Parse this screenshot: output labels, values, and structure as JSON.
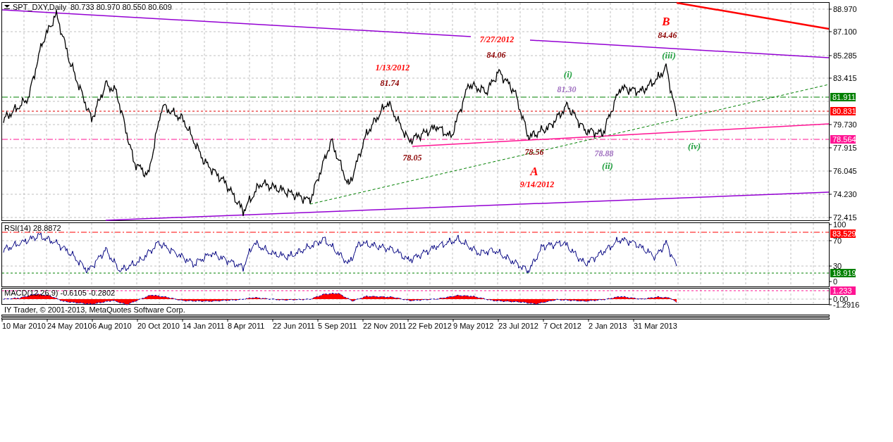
{
  "chart_header": {
    "symbol": "SPT_DXY,Daily",
    "ohlc": "80.733 80.970 80.550 80.609"
  },
  "price_axis": [
    {
      "kind": "tick",
      "text": "88.970"
    },
    {
      "kind": "tick",
      "text": "87.100"
    },
    {
      "kind": "tick",
      "text": "85.285"
    },
    {
      "kind": "tick",
      "text": "83.415"
    },
    {
      "kind": "tag",
      "text": "81.911",
      "color": "#008000"
    },
    {
      "kind": "tag",
      "text": "80.831",
      "color": "#ff0000"
    },
    {
      "kind": "tick",
      "text": "79.730"
    },
    {
      "kind": "tag",
      "text": "78.564",
      "color": "#ff1493"
    },
    {
      "kind": "tick",
      "text": "77.915"
    },
    {
      "kind": "tick",
      "text": "76.045"
    },
    {
      "kind": "tick",
      "text": "74.230"
    },
    {
      "kind": "tick",
      "text": "72.415"
    }
  ],
  "annotations": [
    {
      "kind": "wave",
      "text": "B",
      "color": "#ff0000"
    },
    {
      "kind": "price",
      "text": "84.46",
      "color": "#8b0000"
    },
    {
      "kind": "count",
      "text": "(iii)",
      "color": "#22a040"
    },
    {
      "kind": "date",
      "text": "7/27/2012",
      "color": "#ff0000"
    },
    {
      "kind": "price",
      "text": "84.06",
      "color": "#8b0000"
    },
    {
      "kind": "date",
      "text": "1/13/2012",
      "color": "#ff0000"
    },
    {
      "kind": "price",
      "text": "81.74",
      "color": "#8b0000"
    },
    {
      "kind": "count",
      "text": "(i)",
      "color": "#22a040"
    },
    {
      "kind": "price",
      "text": "81.30",
      "color": "#a070c0"
    },
    {
      "kind": "price",
      "text": "78.05",
      "color": "#8b0000"
    },
    {
      "kind": "price",
      "text": "78.56",
      "color": "#8b0000"
    },
    {
      "kind": "price",
      "text": "78.88",
      "color": "#a070c0"
    },
    {
      "kind": "count",
      "text": "(ii)",
      "color": "#22a040"
    },
    {
      "kind": "wave",
      "text": "A",
      "color": "#ff0000"
    },
    {
      "kind": "date",
      "text": "9/14/2012",
      "color": "#ff0000"
    },
    {
      "kind": "count",
      "text": "(iv)",
      "color": "#22a040"
    }
  ],
  "rsi": {
    "title": "RSI(14) 28.8872",
    "axis": [
      {
        "kind": "tick",
        "text": "100"
      },
      {
        "kind": "tag",
        "text": "83.529",
        "color": "#ff0000"
      },
      {
        "kind": "tick",
        "text": "70"
      },
      {
        "kind": "tick",
        "text": "30"
      },
      {
        "kind": "tag",
        "text": "18.919",
        "color": "#008000"
      },
      {
        "kind": "tick",
        "text": "0"
      }
    ]
  },
  "macd": {
    "title": "MACD(12,26,9) -0.6105 -0.2802",
    "axis": [
      {
        "kind": "tag",
        "text": "1.233",
        "color": "#ff1493"
      },
      {
        "kind": "tick",
        "text": "0.00"
      },
      {
        "kind": "tick",
        "text": "-1.2916"
      }
    ]
  },
  "copyright": "IY Trader, © 2001-2013, MetaQuotes Software Corp.",
  "time_axis": [
    "10 Mar 2010",
    "24 May 2010",
    "6 Aug 2010",
    "20 Oct 2010",
    "14 Jan 2011",
    "8 Apr 2011",
    "22 Jun 2011",
    "5 Sep 2011",
    "22 Nov 2011",
    "22 Feb 2012",
    "9 May 2012",
    "23 Jul 2012",
    "7 Oct 2012",
    "2 Jan 2013",
    "31 Mar 2013"
  ]
}
